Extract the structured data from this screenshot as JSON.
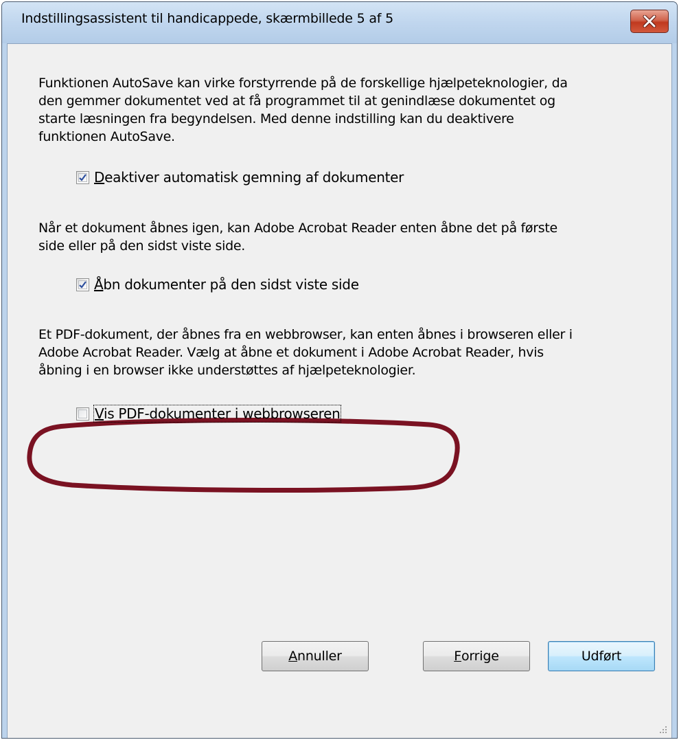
{
  "window": {
    "title": "Indstillingsassistent til handicappede, skærmbillede 5 af 5",
    "close_icon": "close-icon"
  },
  "sections": [
    {
      "text_lines": [
        "Funktionen AutoSave kan virke forstyrrende på de forskellige hjælpeteknologier, da",
        "den gemmer dokumentet ved at få programmet til at genindlæse dokumentet og",
        "starte læsningen fra begyndelsen. Med denne indstilling kan du deaktivere",
        "funktionen AutoSave."
      ],
      "checkbox": {
        "mnemonic": "D",
        "label_rest": "eaktiver automatisk gemning af dokumenter",
        "checked": true
      }
    },
    {
      "text_lines": [
        "Når et dokument åbnes igen, kan Adobe Acrobat Reader enten åbne det på første",
        "side eller på den sidst viste side."
      ],
      "checkbox": {
        "mnemonic": "Å",
        "label_rest": "bn dokumenter på den sidst viste side",
        "checked": true
      }
    },
    {
      "text_lines": [
        "Et PDF-dokument, der åbnes fra en webbrowser, kan enten åbnes i browseren eller i",
        "Adobe Acrobat Reader. Vælg at åbne et dokument i Adobe Acrobat Reader, hvis",
        "åbning i en browser ikke understøttes af hjælpeteknologier."
      ],
      "checkbox": {
        "mnemonic": "V",
        "label_rest": "is PDF-dokumenter i webbrowseren",
        "checked": false,
        "highlighted": true
      }
    }
  ],
  "buttons": {
    "cancel": {
      "mnemonic": "A",
      "rest": "nnuller"
    },
    "previous": {
      "mnemonic": "F",
      "rest": "orrige"
    },
    "finish": {
      "label": "Udført",
      "default": true
    }
  },
  "colors": {
    "highlight_ellipse": "#7a1222",
    "checkmark": "#2d4f9e"
  }
}
